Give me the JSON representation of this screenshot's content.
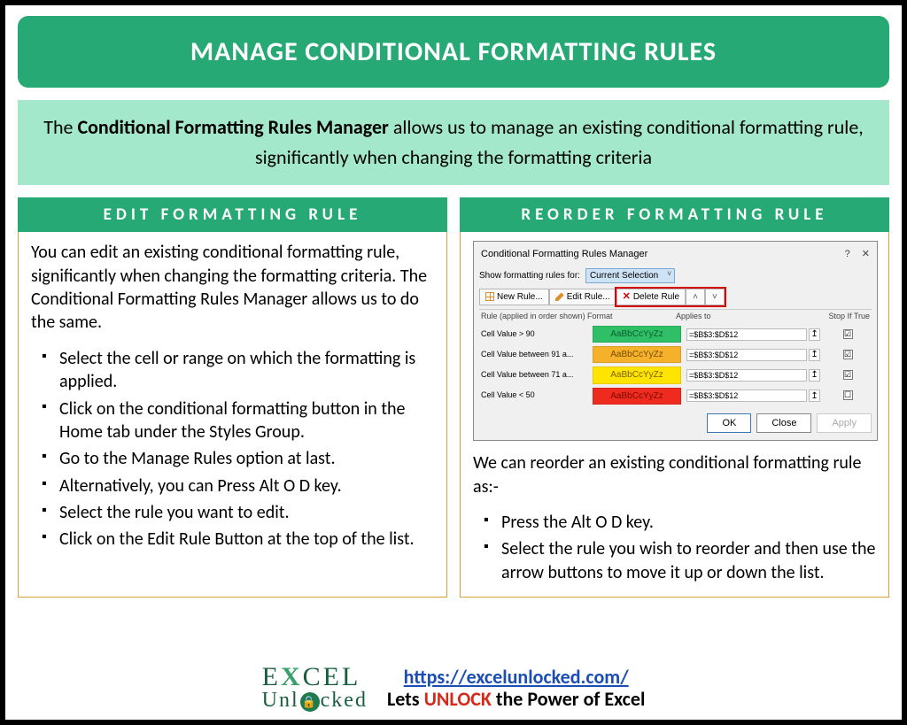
{
  "header": {
    "title": "MANAGE CONDITIONAL FORMATTING RULES"
  },
  "intro": {
    "prefix": "The ",
    "bold": "Conditional Formatting Rules Manager",
    "rest": " allows us to manage an existing conditional formatting rule, significantly when changing the formatting criteria"
  },
  "left": {
    "heading": "EDIT FORMATTING RULE",
    "para": "You can edit an existing conditional formatting rule, significantly when changing the formatting criteria. The Conditional Formatting Rules Manager allows us to do the same.",
    "bullets": [
      "Select the cell or range on which the formatting is applied.",
      "Click on the conditional formatting button in the Home tab under the Styles Group.",
      "Go to the Manage Rules option at last.",
      "Alternatively, you can Press Alt O D key.",
      "Select the rule you want to edit.",
      "Click on the Edit Rule Button at the top of the list."
    ]
  },
  "right": {
    "heading": "REORDER FORMATTING RULE",
    "dialog": {
      "title": "Conditional Formatting Rules Manager",
      "help": "?",
      "close": "✕",
      "show_label": "Show formatting rules for:",
      "show_value": "Current Selection",
      "btn_new": "New Rule...",
      "btn_edit": "Edit Rule...",
      "btn_delete": "Delete Rule",
      "arrow_up": "˄",
      "arrow_down": "˅",
      "col_rule": "Rule (applied in order shown)",
      "col_format": "Format",
      "col_applies": "Applies to",
      "col_stop": "Stop If True",
      "sample": "AaBbCcYyZz",
      "range_icon": "↥",
      "rows": [
        {
          "rule": "Cell Value > 90",
          "cls": "green",
          "applies": "=$B$3:$D$12",
          "chk": "☑"
        },
        {
          "rule": "Cell Value between 91 a...",
          "cls": "amber",
          "applies": "=$B$3:$D$12",
          "chk": "☑"
        },
        {
          "rule": "Cell Value between 71 a...",
          "cls": "yellow",
          "applies": "=$B$3:$D$12",
          "chk": "☑"
        },
        {
          "rule": "Cell Value < 50",
          "cls": "red",
          "applies": "=$B$3:$D$12",
          "chk": "☐"
        }
      ],
      "ok": "OK",
      "closeBtn": "Close",
      "apply": "Apply"
    },
    "para": "We can reorder an existing conditional formatting rule as:-",
    "bullets": [
      "Press the Alt O D key.",
      "Select the rule you wish to reorder and then use the arrow buttons to move it up or down the list."
    ]
  },
  "footer": {
    "logo_top_e": "E",
    "logo_top_x": "X",
    "logo_top_rest": "CEL",
    "logo_bot_pre": "Unl",
    "logo_bot_post": "cked",
    "url": "https://excelunlocked.com/",
    "tag_pre": "Lets ",
    "tag_unlock": "UNLOCK",
    "tag_post": " the Power of Excel"
  }
}
